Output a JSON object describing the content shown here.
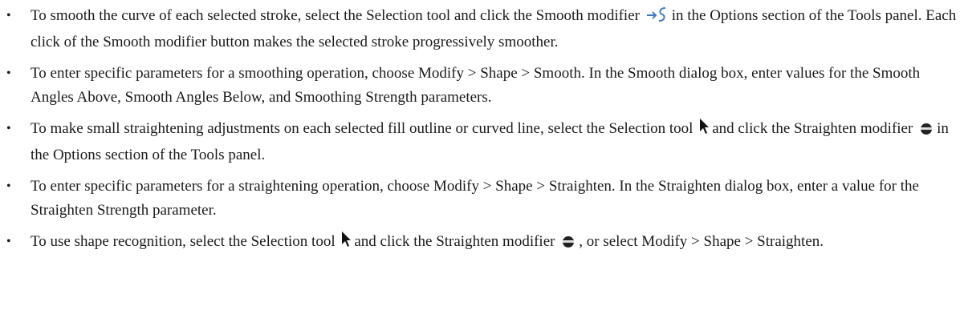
{
  "bullet_glyph": "•",
  "icons": {
    "smooth_modifier": "smooth-modifier-icon",
    "selection_tool": "selection-arrow-icon",
    "straighten_modifier": "straighten-modifier-icon"
  },
  "colors": {
    "text": "#1a1a1a",
    "icon_blue": "#3d7bbf",
    "icon_dark": "#111111"
  },
  "items": [
    {
      "part1": "To smooth the curve of each selected stroke, select the Selection tool and click the Smooth modifier",
      "part2": "in the Options section of the Tools panel. Each click of the Smooth modifier button makes the selected stroke progressively smoother."
    },
    {
      "text": "To enter specific parameters for a smoothing operation, choose Modify > Shape > Smooth. In the Smooth dialog box, enter values for the Smooth Angles Above, Smooth Angles Below, and Smoothing Strength parameters."
    },
    {
      "part1": "To make small straightening adjustments on each selected fill outline or curved line, select the Selection tool",
      "part2": "and click the Straighten modifier",
      "part3": "in the Options section of the Tools panel."
    },
    {
      "text": "To enter specific parameters for a straightening operation, choose Modify > Shape > Straighten. In the Straighten dialog box, enter a value for the Straighten Strength parameter."
    },
    {
      "part1": "To use shape recognition, select the Selection tool",
      "part2": "and click the Straighten modifier",
      "part3": ", or select Modify > Shape > Straighten."
    }
  ]
}
